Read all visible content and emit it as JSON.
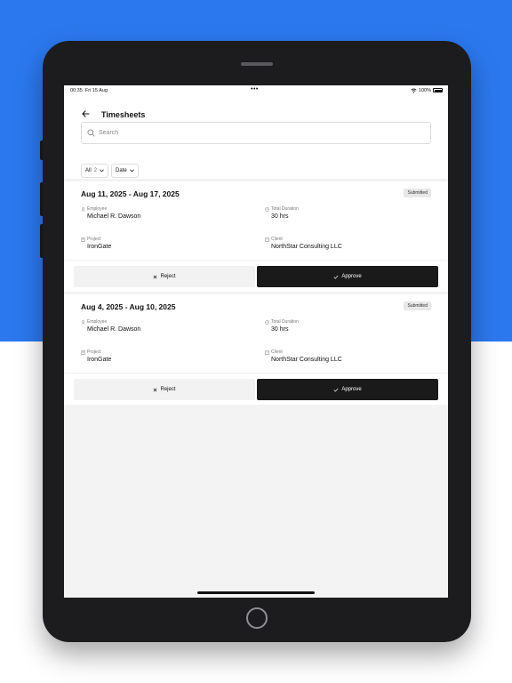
{
  "status_bar": {
    "time": "00:35",
    "date": "Fri 15 Aug",
    "dots": "•••",
    "battery": "100%"
  },
  "header": {
    "title": "Timesheets"
  },
  "search": {
    "placeholder": "Search",
    "value": ""
  },
  "filters": [
    {
      "label": "All",
      "count": "2"
    },
    {
      "label": "Date"
    }
  ],
  "field_labels": {
    "employee": "Employee",
    "duration": "Total Duration",
    "project": "Project",
    "client": "Client"
  },
  "actions": {
    "reject": "Reject",
    "approve": "Approve"
  },
  "timesheets": [
    {
      "period": "Aug 11, 2025 - Aug 17, 2025",
      "status": "Submitted",
      "employee": "Michael R. Dawson",
      "duration": "30 hrs",
      "project": "IronGate",
      "client": "NorthStar Consulting LLC"
    },
    {
      "period": "Aug 4, 2025 - Aug 10, 2025",
      "status": "Submitted",
      "employee": "Michael R. Dawson",
      "duration": "30 hrs",
      "project": "IronGate",
      "client": "NorthStar Consulting LLC"
    }
  ],
  "colors": {
    "accent_background": "#2b78ee",
    "approve_button": "#1a1a1a",
    "device_frame": "#1c1c1e"
  }
}
